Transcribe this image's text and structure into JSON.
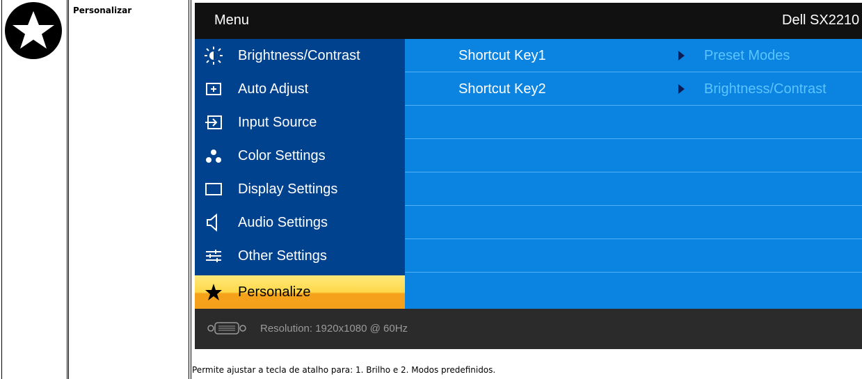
{
  "section": {
    "title": "Personalizar",
    "icon": "star-circle-icon"
  },
  "osd": {
    "header": {
      "menu_label": "Menu",
      "model": "Dell SX2210"
    },
    "menu_items": [
      {
        "label": "Brightness/Contrast",
        "icon": "brightness-icon"
      },
      {
        "label": "Auto Adjust",
        "icon": "auto-adjust-icon"
      },
      {
        "label": "Input Source",
        "icon": "input-source-icon"
      },
      {
        "label": "Color Settings",
        "icon": "color-settings-icon"
      },
      {
        "label": "Display Settings",
        "icon": "display-settings-icon"
      },
      {
        "label": "Audio Settings",
        "icon": "speaker-icon"
      },
      {
        "label": "Other Settings",
        "icon": "sliders-icon"
      },
      {
        "label": "Personalize",
        "icon": "star-icon",
        "active": true
      }
    ],
    "options": [
      {
        "label": "Shortcut Key1",
        "value": "Preset Modes"
      },
      {
        "label": "Shortcut Key2",
        "value": "Brightness/Contrast"
      }
    ],
    "footer": {
      "resolution": "Resolution: 1920x1080 @ 60Hz",
      "icon": "vga-connector-icon"
    }
  },
  "description": "Permite ajustar a tecla de atalho para: 1. Brilho e 2. Modos predefinidos.",
  "colors": {
    "menu_left_bg": "#00428e",
    "menu_right_bg": "#0a84e0",
    "active_item": "#ffd84a",
    "value_text": "#5cc4ff"
  }
}
